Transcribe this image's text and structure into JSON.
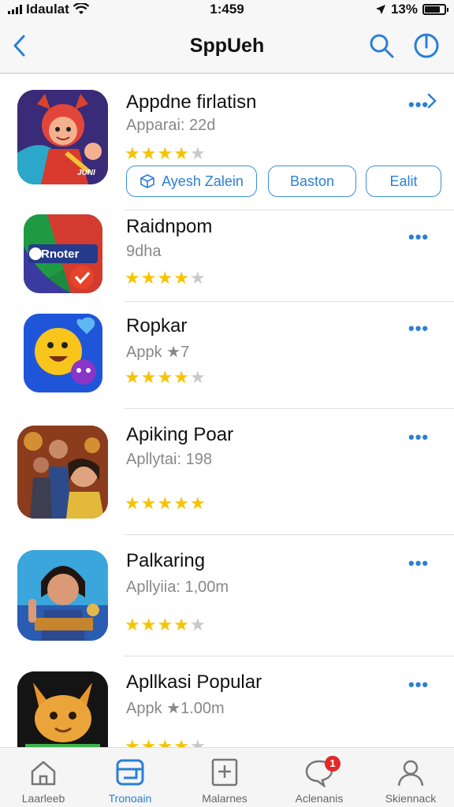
{
  "status_bar": {
    "carrier": "Idaulat",
    "time": "1:459",
    "battery": "13%",
    "battery_level": 0.8
  },
  "nav": {
    "title": "SppUeh",
    "back_icon": "chevron-left-icon",
    "search_icon": "search-icon",
    "power_icon": "power-icon"
  },
  "apps": [
    {
      "name": "Appdne firlatisn",
      "subtitle": "Apparai: 22d",
      "rating": 4,
      "actions": [
        "Ayesh Zalein",
        "Baston",
        "Ealit"
      ],
      "icon_label": "JUNI"
    },
    {
      "name": "Raidnpom",
      "subtitle": "9dha",
      "rating": 4,
      "icon_label": "Rnoter"
    },
    {
      "name": "Ropkar",
      "subtitle": "Appk ★7",
      "rating": 4
    },
    {
      "name": "Apiking Poar",
      "subtitle": "Apllytai: 198",
      "rating": 4.5
    },
    {
      "name": "Palkaring",
      "subtitle": "Apllyiia: 1,00m",
      "rating": 4
    },
    {
      "name": "Apllkasi Popular",
      "subtitle": "Appk ★1.00m",
      "rating": 4
    }
  ],
  "tabs": [
    {
      "label": "Laarleeb",
      "icon": "home-icon"
    },
    {
      "label": "Tronoain",
      "icon": "apps-icon",
      "active": true
    },
    {
      "label": "Malarnes",
      "icon": "grid-icon"
    },
    {
      "label": "Aclenanis",
      "icon": "chat-icon",
      "badge": "1"
    },
    {
      "label": "Skiennack",
      "icon": "person-icon"
    }
  ],
  "colors": {
    "accent": "#2a7fd6",
    "star": "#f5c400",
    "badge": "#e02a2a"
  }
}
